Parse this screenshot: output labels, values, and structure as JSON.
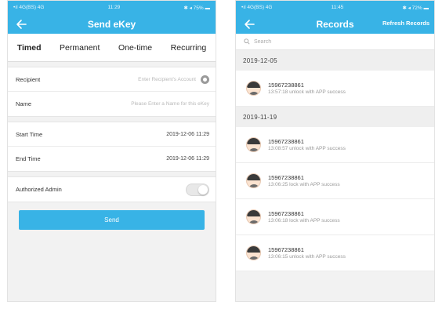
{
  "left": {
    "statusbar": {
      "carrier": "•ıl 4G(BS) 4G",
      "time": "11:29",
      "battery": "✱ ◂ 75% ▬"
    },
    "title": "Send eKey",
    "tabs": [
      "Timed",
      "Permanent",
      "One-time",
      "Recurring"
    ],
    "recipient": {
      "label": "Recipient",
      "placeholder": "Enter Recipient's Account"
    },
    "name": {
      "label": "Name",
      "placeholder": "Please Enter a Name for this eKey"
    },
    "start": {
      "label": "Start Time",
      "value": "2019-12-06 11:29"
    },
    "end": {
      "label": "End Time",
      "value": "2019-12-06 11:29"
    },
    "admin": {
      "label": "Authorized Admin",
      "enabled": false
    },
    "send_label": "Send"
  },
  "right": {
    "statusbar": {
      "carrier": "•ıl 4G(BS) 4G",
      "time": "11:45",
      "battery": "✱ ◂ 72% ▬"
    },
    "title": "Records",
    "refresh_label": "Refresh Records",
    "search_placeholder": "Search",
    "groups": [
      {
        "date": "2019-12-05",
        "records": [
          {
            "phone": "15967238861",
            "detail": "13:57:18 unlock with APP success"
          }
        ]
      },
      {
        "date": "2019-11-19",
        "records": [
          {
            "phone": "15967238861",
            "detail": "13:08:57 unlock with APP success"
          },
          {
            "phone": "15967238861",
            "detail": "13:06:25 lock with APP success"
          },
          {
            "phone": "15967238861",
            "detail": "13:06:18 lock with APP success"
          },
          {
            "phone": "15967238861",
            "detail": "13:06:15 unlock with APP success"
          }
        ]
      }
    ]
  },
  "colors": {
    "accent": "#38b3e6",
    "background": "#f2f2f2"
  }
}
